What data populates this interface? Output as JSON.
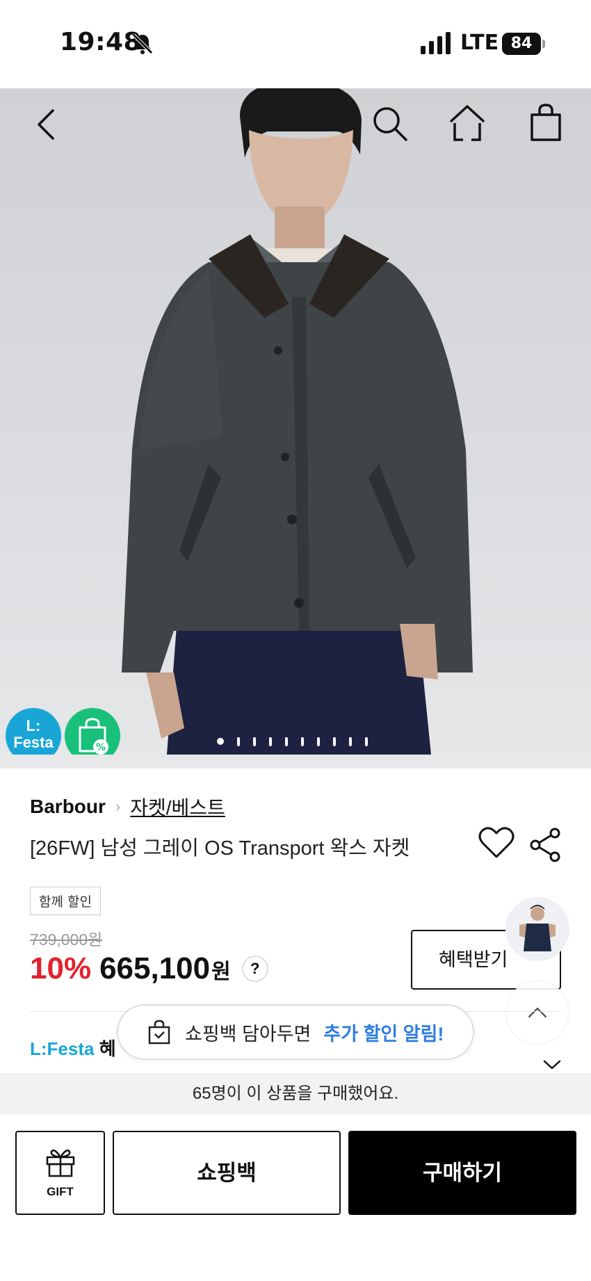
{
  "status_bar": {
    "time": "19:48",
    "network": "LTE",
    "battery": "84"
  },
  "hero": {
    "badge_lfesta_line1": "L:",
    "badge_lfesta_line2": "Festa",
    "slide_count": 10,
    "active_slide": 1
  },
  "product": {
    "brand": "Barbour",
    "category": "자켓/베스트",
    "title": "[26FW] 남성 그레이 OS Transport 왁스 자켓",
    "tag": "함께 할인",
    "original_price": "739,000원",
    "discount": "10%",
    "sale_price": "665,100",
    "currency": "원",
    "help_label": "?",
    "benefit_button": "혜택받기"
  },
  "lfesta": {
    "logo": "L:Festa",
    "text": "혜"
  },
  "toast": {
    "text": "쇼핑백 담아두면",
    "highlight": "추가 할인 알림!"
  },
  "purchase_banner": "65명이 이 상품을 구매했어요.",
  "bottom_bar": {
    "gift_label": "GIFT",
    "cart_label": "쇼핑백",
    "buy_label": "구매하기"
  }
}
